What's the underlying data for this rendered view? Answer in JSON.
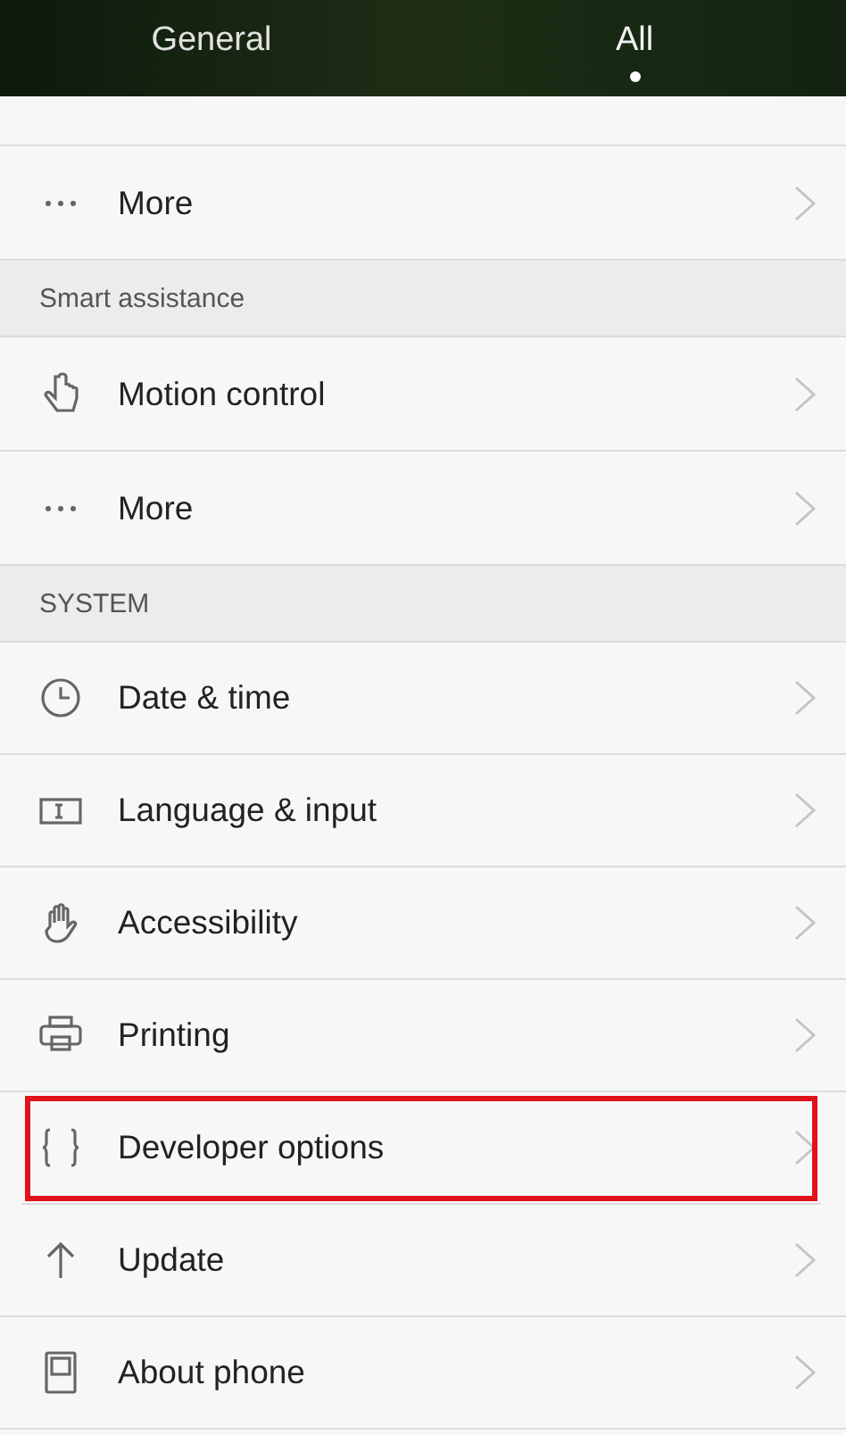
{
  "tabs": [
    {
      "label": "General",
      "selected": false
    },
    {
      "label": "All",
      "selected": true
    }
  ],
  "sections": [
    {
      "items": [
        {
          "kind": "more",
          "label": "More",
          "highlighted": false
        }
      ]
    },
    {
      "title": "Smart assistance",
      "items": [
        {
          "kind": "motion",
          "label": "Motion control",
          "highlighted": false
        },
        {
          "kind": "more",
          "label": "More",
          "highlighted": false
        }
      ]
    },
    {
      "title": "SYSTEM",
      "items": [
        {
          "kind": "clock",
          "label": "Date & time",
          "highlighted": false
        },
        {
          "kind": "input",
          "label": "Language & input",
          "highlighted": false
        },
        {
          "kind": "hand",
          "label": "Accessibility",
          "highlighted": false
        },
        {
          "kind": "printer",
          "label": "Printing",
          "highlighted": false
        },
        {
          "kind": "braces",
          "label": "Developer options",
          "highlighted": true
        },
        {
          "kind": "update",
          "label": "Update",
          "highlighted": false
        },
        {
          "kind": "phone",
          "label": "About phone",
          "highlighted": false
        }
      ]
    }
  ]
}
